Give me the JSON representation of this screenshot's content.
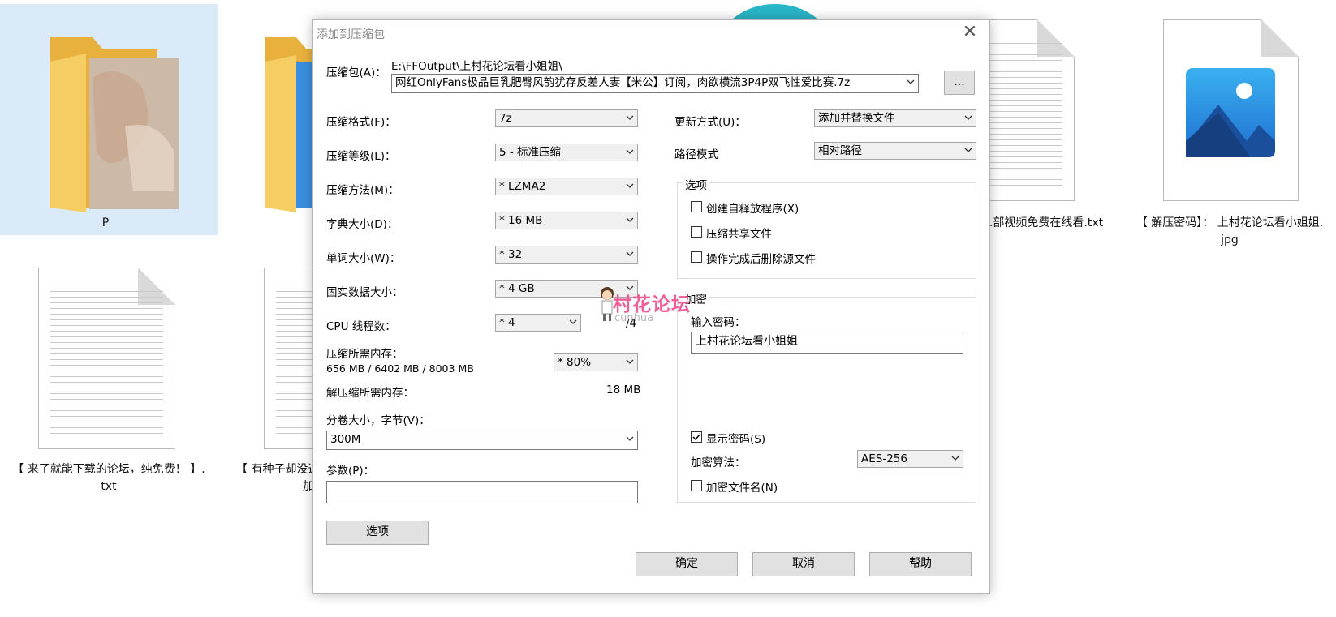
{
  "desktop": {
    "files": [
      {
        "name": "P",
        "type": "folder",
        "selected": true
      },
      {
        "name": "",
        "type": "folder"
      },
      {
        "name": "...部视频免费在线看.txt",
        "type": "txt"
      },
      {
        "name_line1": "【 解压密码】： 上村花论坛看小姐姐.",
        "name_line2": "jpg",
        "type": "image"
      },
      {
        "name_line1": "【 来了就能下载的论坛，纯免费！ 】.",
        "name_line2": "txt",
        "type": "txt"
      },
      {
        "name_line1": "【 有种子却没这",
        "name_line2": "加",
        "type": "txt"
      }
    ]
  },
  "dialog": {
    "title": "添加到压缩包",
    "archive_label": "压缩包(A)：",
    "archive_path": "E:\\FFOutput\\上村花论坛看小姐姐\\",
    "archive_name": "网红OnlyFans极品巨乳肥臀风韵犹存反差人妻【米公】订阅，肉欲横流3P4P双飞性爱比赛.7z",
    "browse_label": "...",
    "left": {
      "format_label": "压缩格式(F)：",
      "format_value": "7z",
      "level_label": "压缩等级(L)：",
      "level_value": "5 - 标准压缩",
      "method_label": "压缩方法(M)：",
      "method_value": "*  LZMA2",
      "dict_label": "字典大小(D)：",
      "dict_value": "*  16 MB",
      "word_label": "单词大小(W)：",
      "word_value": "*  32",
      "solid_label": "固实数据大小：",
      "solid_value": "*  4 GB",
      "cpu_label": "CPU 线程数：",
      "cpu_value": "*  4",
      "cpu_total": "/4",
      "mem_label": "压缩所需内存：",
      "mem_value": "656 MB / 6402 MB / 8003 MB",
      "mem_percent": "* 80%",
      "decomp_label": "解压缩所需内存：",
      "decomp_value": "18 MB",
      "volume_label": "分卷大小，字节(V)：",
      "volume_value": "300M",
      "params_label": "参数(P)：",
      "params_value": "",
      "options_button": "选项"
    },
    "right": {
      "update_label": "更新方式(U)：",
      "update_value": "添加并替换文件",
      "path_label": "路径模式",
      "path_value": "相对路径",
      "options_group": "选项",
      "opt_sfx": "创建自释放程序(X)",
      "opt_shared": "压缩共享文件",
      "opt_delete": "操作完成后删除源文件",
      "encrypt_group": "加密",
      "password_label": "输入密码：",
      "password_value": "上村花论坛看小姐姐",
      "show_password": "显示密码(S)",
      "encrypt_method_label": "加密算法：",
      "encrypt_method_value": "AES-256",
      "encrypt_names": "加密文件名(N)"
    },
    "buttons": {
      "ok": "确定",
      "cancel": "取消",
      "help": "帮助"
    }
  },
  "watermark": {
    "text": "村花论坛",
    "sub": "cunhua"
  },
  "colors": {
    "folder": "#f5c85a",
    "selection": "#dbeaf8",
    "image_icon": "#2a7bd6",
    "watermark": "#ef4d8c"
  }
}
